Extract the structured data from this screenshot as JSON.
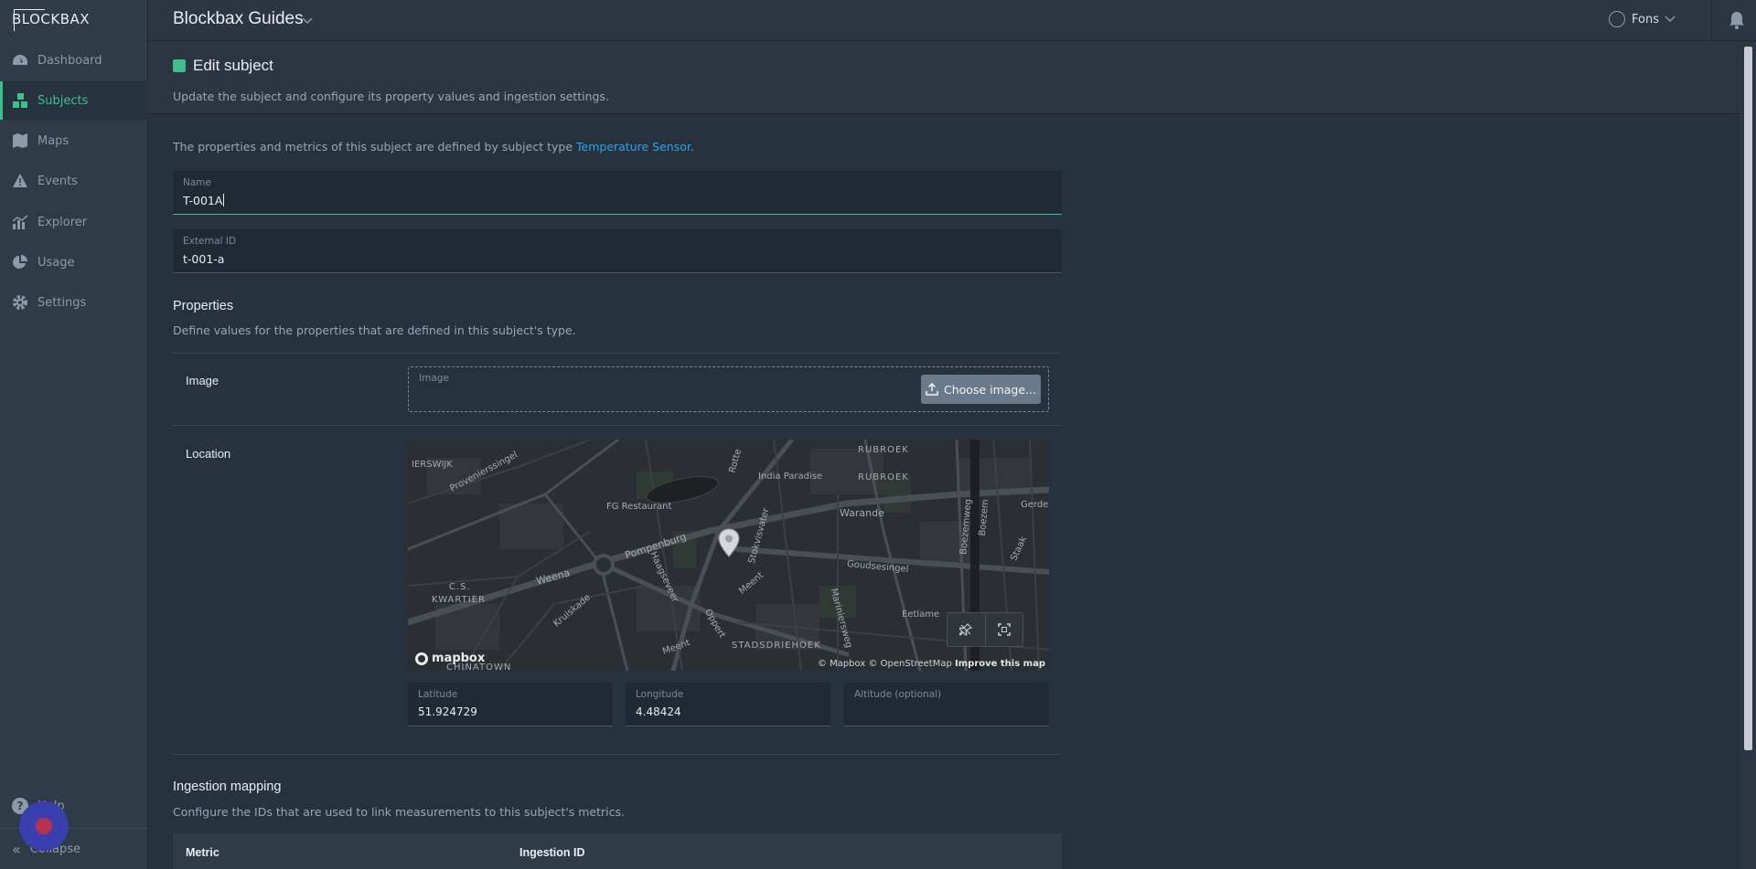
{
  "sidebar": {
    "logo": "BLOCKBAX",
    "items": [
      {
        "label": "Dashboard",
        "icon": "gauge-icon",
        "active": false
      },
      {
        "label": "Subjects",
        "icon": "blocks-icon",
        "active": true
      },
      {
        "label": "Maps",
        "icon": "map-icon",
        "active": false
      },
      {
        "label": "Events",
        "icon": "warning-icon",
        "active": false
      },
      {
        "label": "Explorer",
        "icon": "chart-icon",
        "active": false
      },
      {
        "label": "Usage",
        "icon": "pie-icon",
        "active": false
      },
      {
        "label": "Settings",
        "icon": "gear-icon",
        "active": false
      }
    ],
    "help_label": "Help",
    "collapse_label": "Collapse"
  },
  "topbar": {
    "org_name": "Blockbax Guides",
    "user_name": "Fons"
  },
  "header": {
    "title": "Edit subject",
    "subtitle": "Update the subject and configure its property values and ingestion settings."
  },
  "form": {
    "type_note_prefix": "The properties and metrics of this subject are defined by subject type ",
    "type_link": "Temperature Sensor",
    "type_note_suffix": ".",
    "name_label": "Name",
    "name_value": "T-001A",
    "external_id_label": "External ID",
    "external_id_value": "t-001-a"
  },
  "properties": {
    "title": "Properties",
    "description": "Define values for the properties that are defined in this subject's type.",
    "image_label": "Image",
    "image_field_label": "Image",
    "choose_button": "Choose image...",
    "location_label": "Location",
    "map": {
      "labels": [
        "IERSWIJK",
        "Provenierssingel",
        "RUBROEK",
        "RUBROEK",
        "India Paradise",
        "Rotte",
        "Gerdes",
        "FG Restaurant",
        "Warande",
        "Pompenburg",
        "Stokvisvater",
        "Boezemweg",
        "Boezem",
        "Staak",
        "C.S.",
        "KWARTIER",
        "Weena",
        "Haagseveer",
        "Goudsesingel",
        "Meent",
        "Kruiskade",
        "Oppert",
        "Mariniersweg",
        "Eetlame",
        "Meent",
        "STADSDRIEHOEK",
        "CHINATOWN"
      ],
      "logo": "mapbox",
      "attribution_1": "© Mapbox",
      "attribution_2": "© OpenStreetMap",
      "attribution_3": "Improve this map"
    },
    "latitude_label": "Latitude",
    "latitude_value": "51.924729",
    "longitude_label": "Longitude",
    "longitude_value": "4.48424",
    "altitude_label": "Altitude (optional)",
    "altitude_value": ""
  },
  "ingestion": {
    "title": "Ingestion mapping",
    "description": "Configure the IDs that are used to link measurements to this subject's metrics.",
    "col_metric": "Metric",
    "col_ingestion_id": "Ingestion ID"
  },
  "colors": {
    "accent": "#3fbf8c",
    "link": "#2ea3ea",
    "background": "#26323e",
    "sidebar": "#2f3b47"
  }
}
